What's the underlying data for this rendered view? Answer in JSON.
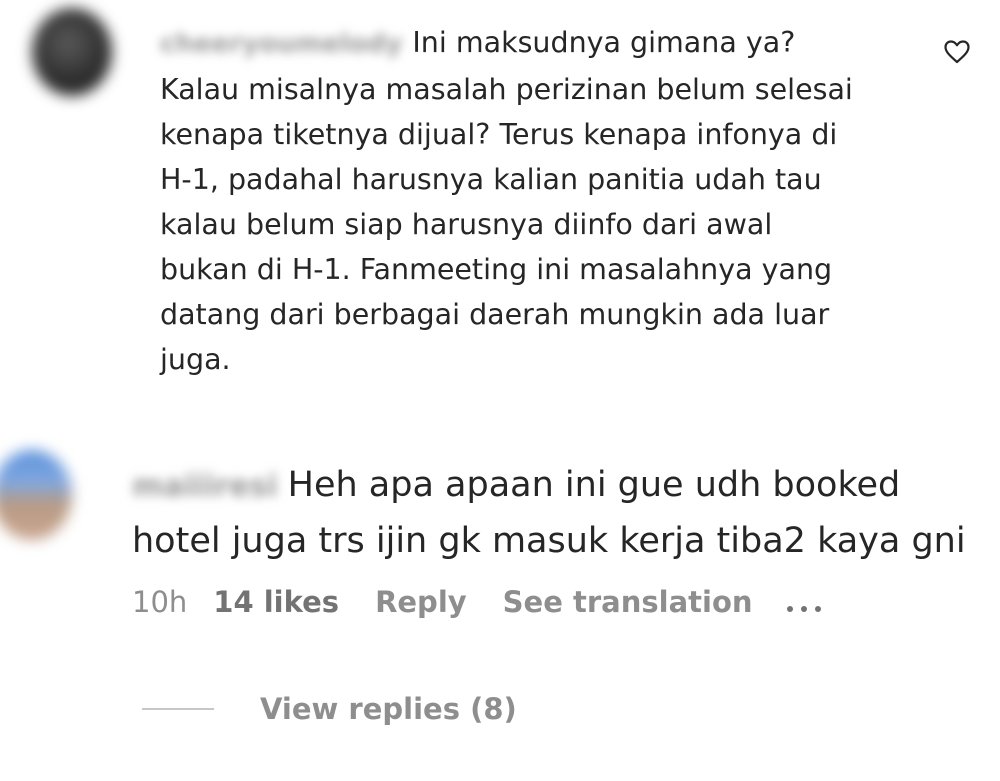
{
  "comments": [
    {
      "username": "cheeryoumelody",
      "text": "Ini maksudnya gimana ya?\nKalau misalnya masalah perizinan belum selesai\nkenapa tiketnya dijual? Terus kenapa infonya di\nH-1, padahal harusnya kalian panitia udah tau\nkalau belum siap harusnya diinfo dari awal\nbukan di H-1. Fanmeeting ini masalahnya yang\ndatang dari berbagai daerah mungkin ada luar\njuga.",
      "like_icon": "heart-outline-icon"
    },
    {
      "username": "maiiiresi",
      "text": "Heh apa apaan ini gue udh booked\nhotel juga trs ijin gk masuk kerja tiba2 kaya gni",
      "time": "10h",
      "likes": "14 likes",
      "reply_label": "Reply",
      "translation_label": "See translation",
      "more_icon": "more-options-icon",
      "view_replies_label": "View replies (8)"
    }
  ]
}
